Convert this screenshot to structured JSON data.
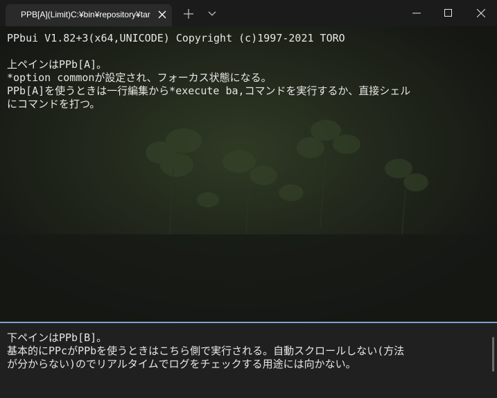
{
  "tab": {
    "title": "PPB[A](Limit)C:¥bin¥repository¥tar"
  },
  "top_pane": {
    "lines": [
      "PPbui V1.82+3(x64,UNICODE) Copyright (c)1997-2021 TORO",
      "",
      "上ペインはPPb[A]。",
      "*option commonが設定され、フォーカス状態になる。",
      "PPb[A]を使うときは一行編集から*execute ba,コマンドを実行するか、直接シェル",
      "にコマンドを打つ。"
    ]
  },
  "bottom_pane": {
    "lines": [
      "下ペインはPPb[B]。",
      "基本的にPPcがPPbを使うときはこちら側で実行される。自動スクロールしない(方法",
      "が分からない)のでリアルタイムでログをチェックする用途には向かない。"
    ]
  },
  "colors": {
    "accent_divider": "#7aa6c8",
    "text": "#e6e6e6",
    "titlebar": "#1b1b1b"
  },
  "icons": {
    "tab_close": "close-icon",
    "new_tab": "plus-icon",
    "dropdown": "chevron-down-icon",
    "minimize": "minimize-icon",
    "maximize": "maximize-icon",
    "close": "close-icon"
  }
}
